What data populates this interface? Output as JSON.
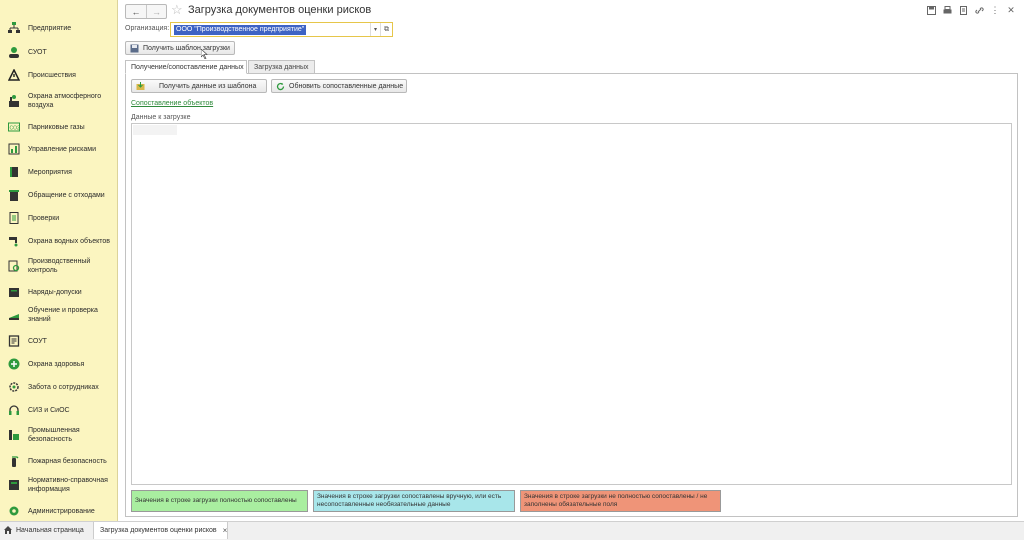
{
  "sidebar": {
    "items": [
      {
        "label": "Предприятие",
        "icon": "org-structure-icon"
      },
      {
        "label": "СУОТ",
        "icon": "gear-people-icon"
      },
      {
        "label": "Происшествия",
        "icon": "warning-triangle-icon"
      },
      {
        "label": "Охрана атмосферного воздуха",
        "icon": "factory-smoke-icon"
      },
      {
        "label": "Парниковые газы",
        "icon": "co2-icon"
      },
      {
        "label": "Управление рисками",
        "icon": "risk-chart-icon"
      },
      {
        "label": "Мероприятия",
        "icon": "book-icon"
      },
      {
        "label": "Обращение с отходами",
        "icon": "waste-bin-icon"
      },
      {
        "label": "Проверки",
        "icon": "checklist-icon"
      },
      {
        "label": "Охрана водных объектов",
        "icon": "water-tap-icon"
      },
      {
        "label": "Производственный контроль",
        "icon": "inspection-icon"
      },
      {
        "label": "Наряды-допуски",
        "icon": "permit-folder-icon"
      },
      {
        "label": "Обучение и проверка знаний",
        "icon": "training-icon"
      },
      {
        "label": "СОУТ",
        "icon": "clipboard-icon"
      },
      {
        "label": "Охрана здоровья",
        "icon": "health-icon"
      },
      {
        "label": "Забота о сотрудниках",
        "icon": "care-gear-icon"
      },
      {
        "label": "СИЗ и СиОС",
        "icon": "headphones-icon"
      },
      {
        "label": "Промышленная безопасность",
        "icon": "industrial-safety-icon"
      },
      {
        "label": "Пожарная безопасность",
        "icon": "fire-extinguisher-icon"
      },
      {
        "label": "Нормативно-справочная информация",
        "icon": "reference-book-icon"
      },
      {
        "label": "Администрирование",
        "icon": "admin-gear-icon"
      }
    ]
  },
  "header": {
    "back": "←",
    "forward": "→",
    "title": "Загрузка документов оценки рисков"
  },
  "organization": {
    "label": "Организация:",
    "value": "ООО \"Производственное предприятие\""
  },
  "toolbar": {
    "get_template": "Получить шаблон загрузки"
  },
  "tabs": [
    {
      "label": "Получение/сопоставление данных",
      "active": true
    },
    {
      "label": "Загрузка данных",
      "active": false
    }
  ],
  "actions": {
    "get_data": "Получить данные из шаблона",
    "refresh": "Обновить сопоставленные данные",
    "map_objects": "Сопоставление объектов"
  },
  "data_section": {
    "label": "Данные к загрузке"
  },
  "legend": [
    {
      "text": "Значения в строке загрузки полностью сопоставлены",
      "color": "#a9eea0"
    },
    {
      "text": "Значения в строке загрузки сопоставлены вручную, или есть несопоставленные необязательные данные",
      "color": "#a8e6ea"
    },
    {
      "text": "Значения в строке загрузки не полностью сопоставлены / не заполнены обязательные поля",
      "color": "#ef9478"
    }
  ],
  "bottom_tabs": {
    "home": "Начальная страница",
    "doc": "Загрузка документов оценки рисков",
    "close": "×"
  },
  "colors": {
    "sidebar_bg": "#fbf5c0",
    "accent_green": "#2e9a3e",
    "selection": "#3e63c4"
  }
}
